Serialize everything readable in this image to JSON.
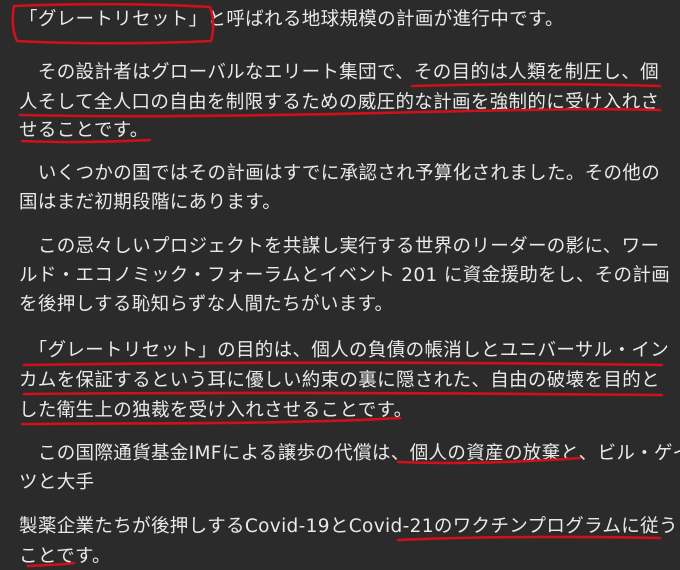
{
  "document": {
    "paragraphs": [
      {
        "lines": [
          "「グレートリセット」と呼ばれる地球規模の計画が進行中です。"
        ]
      },
      {
        "lines": [
          "　その設計者はグローバルなエリート集団で、その目的は人類を制圧し、個",
          "人そして全人口の自由を制限するための威圧的な計画を強制的に受け入れさ",
          "せることです。"
        ]
      },
      {
        "lines": [
          "　いくつかの国ではその計画はすでに承認され予算化されました。その他の",
          "国はまだ初期段階にあります。"
        ]
      },
      {
        "lines": [
          "　この忌々しいプロジェクトを共謀し実行する世界のリーダーの影に、ワー",
          "ルド・エコノミック・フォーラムとイベント 201 に資金援助をし、その計画",
          "を後押しする恥知らずな人間たちがいます。"
        ]
      },
      {
        "lines": [
          "　「グレートリセット」の目的は、個人の負債の帳消しとユニバーサル・イン",
          "カムを保証するという耳に優しい約束の裏に隠された、自由の破壊を目的と",
          "した衛生上の独裁を受け入れさせることです。"
        ]
      },
      {
        "lines": [
          "　この国際通貨基金IMFによる譲歩の代償は、個人の資産の放棄と、ビル・ゲイ",
          "ツと大手"
        ]
      },
      {
        "lines": [
          "製薬企業たちが後押しするCovid-19とCovid-21のワクチンプログラムに従う",
          "ことです。"
        ]
      }
    ]
  },
  "colors": {
    "background": "#2b2b2b",
    "text": "#e9e9e9",
    "annotation": "#d0101a"
  }
}
